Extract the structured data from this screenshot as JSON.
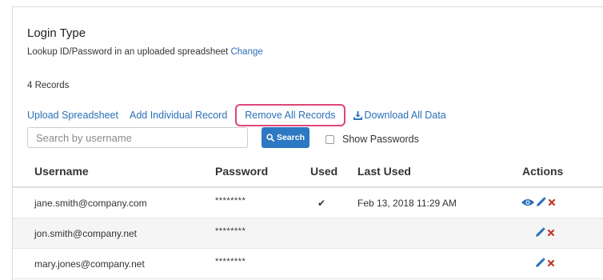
{
  "login": {
    "title": "Login Type",
    "description": "Lookup ID/Password in an uploaded spreadsheet",
    "change_link": "Change"
  },
  "records_count": "4 Records",
  "actions_bar": {
    "upload": "Upload Spreadsheet",
    "add": "Add Individual Record",
    "remove_all": "Remove All Records",
    "download": "Download All Data"
  },
  "search": {
    "placeholder": "Search by username",
    "button": "Search",
    "show_passwords": "Show Passwords"
  },
  "table": {
    "headers": [
      "Username",
      "Password",
      "Used",
      "Last Used",
      "Actions"
    ],
    "rows": [
      {
        "username": "jane.smith@company.com",
        "password": "********",
        "used": "✔",
        "last_used": "Feb 13, 2018 11:29 AM"
      },
      {
        "username": "jon.smith@company.net",
        "password": "********",
        "used": "",
        "last_used": ""
      },
      {
        "username": "mary.jones@company.net",
        "password": "********",
        "used": "",
        "last_used": ""
      }
    ]
  },
  "colors": {
    "link": "#2a70b8",
    "button": "#2d78c2",
    "highlight": "#e0457b",
    "delete": "#c0392b"
  }
}
